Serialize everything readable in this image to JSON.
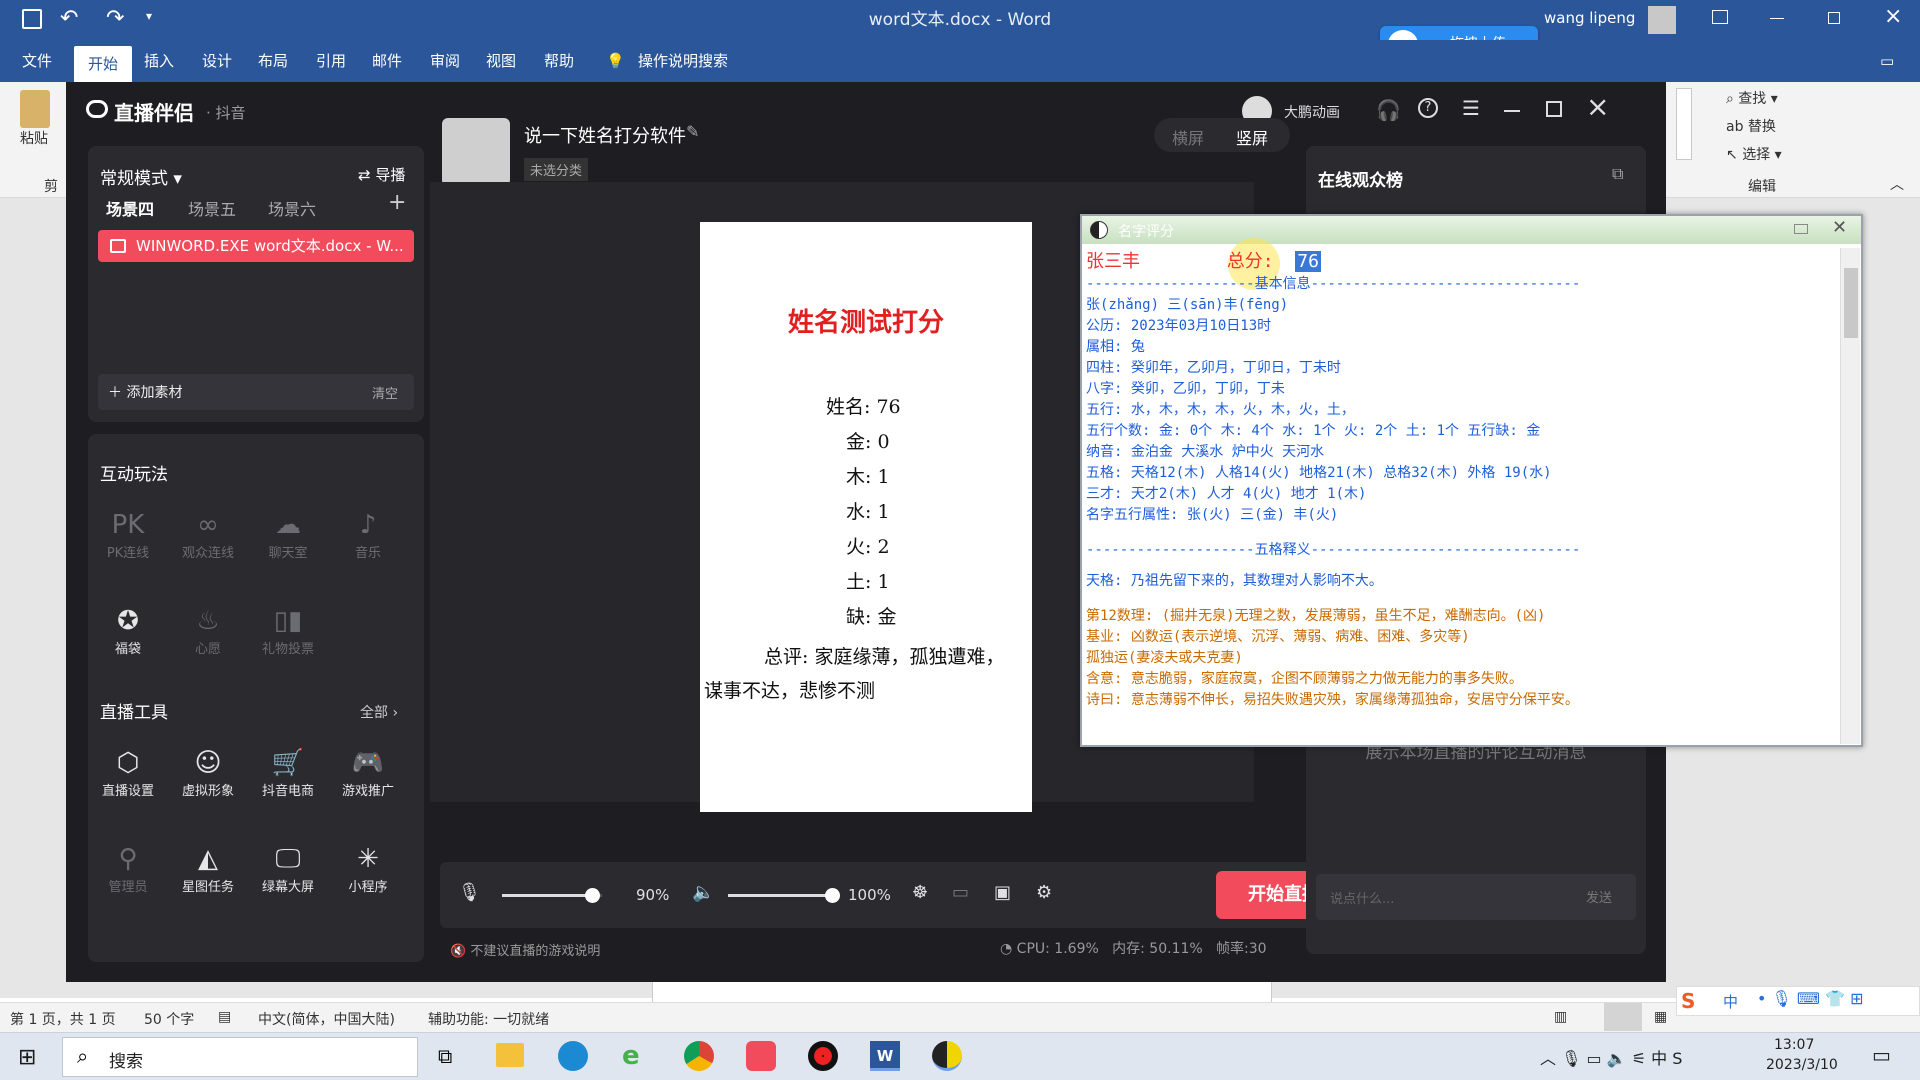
{
  "word": {
    "window_title": "word文本.docx  -  Word",
    "user": "wang lipeng",
    "upload_btn": "拖拽上传",
    "menu": [
      "文件",
      "开始",
      "插入",
      "设计",
      "布局",
      "引用",
      "邮件",
      "审阅",
      "视图",
      "帮助"
    ],
    "tell_me": "操作说明搜索",
    "paste": "粘贴",
    "clipboard": "剪",
    "find": "查找",
    "replace": "替换",
    "select": "选择",
    "edit_group": "编辑",
    "status": {
      "page": "第 1 页，共 1 页",
      "words": "50 个字",
      "lang": "中文(简体，中国大陆)",
      "access": "辅助功能: 一切就绪"
    }
  },
  "stream": {
    "app_name": "直播伴侣",
    "platform": "· 抖音",
    "user": "大鹏动画",
    "mode": "常规模式",
    "guide": "导播",
    "scenes": [
      "场景四",
      "场景五",
      "场景六"
    ],
    "source": "WINWORD.EXE word文本.docx - W...",
    "add_material": "添加素材",
    "clear": "清空",
    "interact_title": "互动玩法",
    "interact": [
      "PK连线",
      "观众连线",
      "聊天室",
      "音乐",
      "福袋",
      "心愿",
      "礼物投票"
    ],
    "tools_title": "直播工具",
    "all": "全部",
    "tools": [
      "直播设置",
      "虚拟形象",
      "抖音电商",
      "游戏推广",
      "管理员",
      "星图任务",
      "绿幕大屏",
      "小程序"
    ],
    "live_title": "说一下姓名打分软件",
    "category": "未选分类",
    "landscape": "横屏",
    "portrait": "竖屏",
    "mic_pct": "90%",
    "vol_pct": "100%",
    "mic_level": 0.9,
    "vol_level": 1.0,
    "start_btn": "开始直播",
    "hint": "不建议直播的游戏说明",
    "cpu": "CPU: 1.69%",
    "mem": "内存: 50.11%",
    "fps": "帧率:30",
    "audience_title": "在线观众榜",
    "comment_hint": "展示本场直播的评论互动消息",
    "say_placeholder": "说点什么...",
    "send": "发送"
  },
  "doc": {
    "title": "姓名测试打分",
    "lines": [
      "姓名: 76",
      "金: 0",
      "木: 1",
      "水: 1",
      "火: 2",
      "土: 1",
      "缺: 金"
    ],
    "summary1": "总评: 家庭缘薄，孤独遭难，",
    "summary2": "谋事不达，悲惨不测"
  },
  "namewin": {
    "title": "名字评分",
    "name": "张三丰",
    "score_label": "总分:",
    "score": "76",
    "sep1": "--------------------基本信息--------------------------------",
    "lines_blue": [
      "张(zhǎng)  三(sān)丰(fēng)",
      "公历: 2023年03月10日13时",
      "属相: 兔",
      "四柱: 癸卯年，乙卯月，丁卯日，丁未时",
      "八字: 癸卯，乙卯，丁卯，丁未",
      "五行: 水，木，木，木，火，木，火，土，",
      "五行个数: 金: 0个  木: 4个  水: 1个  火: 2个  土: 1个          五行缺: 金",
      "纳音: 金泊金  大溪水  炉中火  天河水",
      "五格: 天格12(木)   人格14(火)   地格21(木)   总格32(木)   外格 19(水)",
      "三才: 天才2(木)    人才 4(火)    地才 1(木)",
      "名字五行属性: 张(火)  三(金)  丰(火)"
    ],
    "sep2": "--------------------五格释义--------------------------------",
    "tiange": "天格: 乃祖先留下来的，其数理对人影响不大。",
    "lines_orange": [
      "第12数理: (掘井无泉)无理之数，发展薄弱，虽生不足，难酬志向。(凶)",
      "基业: 凶数运(表示逆境、沉浮、薄弱、病难、困难、多灾等)",
      "孤独运(妻凌夫或夫克妻)",
      "含意: 意志脆弱，家庭寂寞，企图不顾薄弱之力做无能力的事多失败。",
      "诗曰: 意志薄弱不伸长，易招失败遇灾殃，家属缘薄孤独命，安居守分保平安。"
    ]
  },
  "taskbar": {
    "search": "搜索",
    "time": "13:07",
    "date": "2023/3/10",
    "ime": "中"
  }
}
